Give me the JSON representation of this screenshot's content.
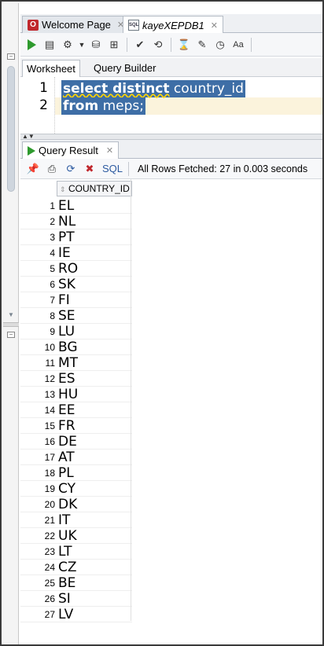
{
  "tabs": [
    {
      "label": "Welcome Page",
      "icon": "oracle-icon",
      "active": false
    },
    {
      "label": "kayeXEPDB1",
      "icon": "sql-worksheet-icon",
      "active": true
    }
  ],
  "subtabs": [
    "Worksheet",
    "Query Builder"
  ],
  "editor": {
    "lines": [
      {
        "num": "1",
        "kw": "select distinct",
        "rest": "country_id"
      },
      {
        "num": "2",
        "kw": "from",
        "rest": "meps;"
      }
    ]
  },
  "result": {
    "tab_label": "Query Result",
    "sql_link": "SQL",
    "status": "All Rows Fetched: 27 in 0.003 seconds",
    "column": "COUNTRY_ID",
    "rows": [
      "EL",
      "NL",
      "PT",
      "IE",
      "RO",
      "SK",
      "FI",
      "SE",
      "LU",
      "BG",
      "MT",
      "ES",
      "HU",
      "EE",
      "FR",
      "DE",
      "AT",
      "PL",
      "CY",
      "DK",
      "IT",
      "UK",
      "LT",
      "CZ",
      "BE",
      "SI",
      "LV"
    ]
  },
  "colors": {
    "selection": "#3e6ea6",
    "run_green": "#2e9a2e",
    "oracle_red": "#c0272d"
  }
}
